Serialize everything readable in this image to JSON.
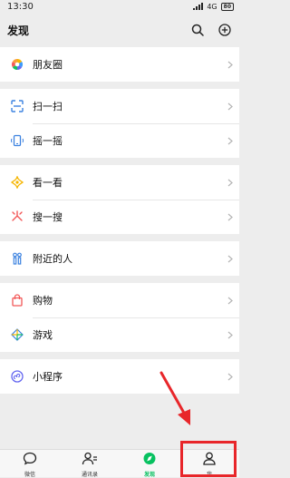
{
  "status_bar": {
    "time": "13:30",
    "network": "4G",
    "battery": "80"
  },
  "header": {
    "title": "发现",
    "search_icon": "search-icon",
    "add_icon": "plus-circle-icon"
  },
  "groups": [
    [
      {
        "label": "朋友圈",
        "icon": "moments-icon"
      }
    ],
    [
      {
        "label": "扫一扫",
        "icon": "scan-icon"
      },
      {
        "label": "摇一摇",
        "icon": "shake-icon"
      }
    ],
    [
      {
        "label": "看一看",
        "icon": "top-stories-icon"
      },
      {
        "label": "搜一搜",
        "icon": "search-feature-icon"
      }
    ],
    [
      {
        "label": "附近的人",
        "icon": "people-nearby-icon"
      }
    ],
    [
      {
        "label": "购物",
        "icon": "shopping-bag-icon"
      },
      {
        "label": "游戏",
        "icon": "games-icon"
      }
    ],
    [
      {
        "label": "小程序",
        "icon": "mini-programs-icon"
      }
    ]
  ],
  "tabbar": {
    "tabs": [
      {
        "label": "微信",
        "icon": "chat-icon"
      },
      {
        "label": "通讯录",
        "icon": "contacts-icon"
      },
      {
        "label": "发现",
        "icon": "discover-icon",
        "active": true
      },
      {
        "label": "我",
        "icon": "me-icon"
      }
    ]
  },
  "colors": {
    "accent": "#07c160",
    "annotation": "#e8262a"
  }
}
